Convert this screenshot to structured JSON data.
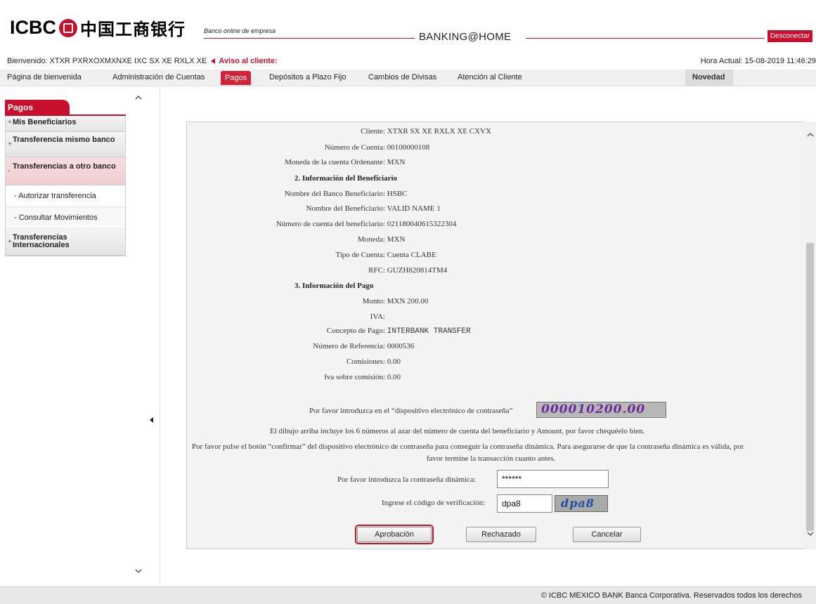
{
  "header": {
    "logo_text": "ICBC",
    "logo_cn": "中国工商银行",
    "tagline": "Banco online de empresa",
    "banking_title": "BANKING@HOME",
    "logout_label": "Desconectar",
    "welcome": "Bienvenido: XTXR PXRXOXMXNXE IXC SX XE RXLX XE",
    "notice": "Aviso al cliente:",
    "clock": "Hora Actual: 15-08-2019 11:46:29"
  },
  "nav": {
    "items": [
      "Página de bienvenida",
      "Administración de Cuentas",
      "Pagos",
      "Depósitos a Plazo Fijo",
      "Cambios de Divisas",
      "Atención al Cliente"
    ],
    "active": "Pagos",
    "novedad": "Novedad"
  },
  "sidebar": {
    "title": "Pagos",
    "items": [
      {
        "label": "Mis Beneficiarios",
        "marker": "+"
      },
      {
        "label": "Transferencia mismo banco",
        "marker": "+"
      },
      {
        "label": "Transferencias a otro banco",
        "marker": "-"
      },
      {
        "label": "Autorizar transferencia",
        "marker": "-"
      },
      {
        "label": "Consultar Movimientos",
        "marker": "-"
      },
      {
        "label": "Transferencias Internacionales",
        "marker": "+"
      }
    ]
  },
  "form": {
    "client_label": "Cliente:",
    "client_value": "XTXR SX XE RXLX XE CXVX",
    "account_label": "Número de Cuenta:",
    "account_value": "00100000108",
    "currency_label": "Moneda de la cuenta Ordenante:",
    "currency_value": "MXN",
    "section2": "2. Información del Beneficiario",
    "bank_label": "Nombre del Banco Beneficiario:",
    "bank_value": "HSBC",
    "benef_label": "Nombre del Beneficiario:",
    "benef_value": "VALID NAME 1",
    "benef_acct_label": "Número de cuenta del beneficiario:",
    "benef_acct_value": "021180040615322304",
    "moneda_label": "Moneda:",
    "moneda_value": "MXN",
    "tipo_label": "Tipo de Cuenta:",
    "tipo_value": "Cuenta CLABE",
    "rfc_label": "RFC:",
    "rfc_value": "GUZH820814TM4",
    "section3": "3. Información del Pago",
    "monto_label": "Monto:",
    "monto_value": "MXN 200.00",
    "iva_label": "IVA:",
    "iva_value": "",
    "concepto_label": "Concepto de Pago:",
    "concepto_value": "INTERBANK TRANSFER",
    "ref_label": "Número de Referencia:",
    "ref_value": "0000536",
    "comisiones_label": "Comisiones:",
    "comisiones_value": "0.00",
    "iva_com_label": "Iva sobre comisión:",
    "iva_com_value": "0.00"
  },
  "security": {
    "device_prompt": "Por favor introduzca en el “dispositivo electrónico de contraseña”",
    "device_code": "000010200.00",
    "note1": "El dibujo arriba incluye los 6 números al azar del número de cuenta del beneficiario y Amount, por favor chequéelo bien.",
    "note2": "Por favor pulse el botón “confirmar” del dispositivo electrónico de contraseña para conseguir la contraseña dinámica. Para asegurarse de que la contraseña dinámica es válida, por",
    "note3": "favor termine la transacción cuanto antes.",
    "dyn_label": "Por favor introduzca la contraseña dinámica:",
    "dyn_value": "******",
    "verif_label": "Ingrese el código de verificación:",
    "verif_value": "dpa8",
    "captcha": "dpa8"
  },
  "buttons": {
    "approve": "Aprobación",
    "reject": "Rechazado",
    "cancel": "Cancelar"
  },
  "footer": {
    "text": "© ICBC MEXICO BANK Banca Corporativa. Reservados todos los derechos"
  },
  "colors": {
    "brand_red": "#c8102e",
    "nav_active": "#d3233a"
  }
}
